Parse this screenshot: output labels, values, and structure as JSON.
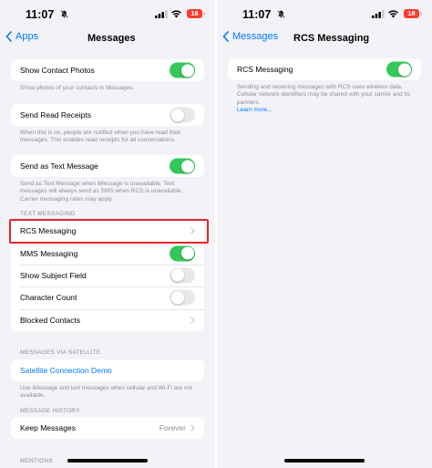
{
  "status": {
    "time": "11:07",
    "battery": "18"
  },
  "left": {
    "nav": {
      "back_label": "Apps",
      "title": "Messages"
    },
    "show_contact_photos": {
      "label": "Show Contact Photos",
      "on": true,
      "footnote": "Show photos of your contacts in Messages."
    },
    "send_read_receipts": {
      "label": "Send Read Receipts",
      "on": false,
      "footnote": "When this is on, people are notified when you have read their messages. This enables read receipts for all conversations."
    },
    "send_as_text": {
      "label": "Send as Text Message",
      "on": true,
      "footnote": "Send as Text Message when iMessage is unavailable. Text messages will always send as SMS when RCS is unavailable. Carrier messaging rates may apply."
    },
    "text_messaging": {
      "header": "TEXT MESSAGING",
      "rcs": "RCS Messaging",
      "mms": {
        "label": "MMS Messaging",
        "on": true
      },
      "subject": {
        "label": "Show Subject Field",
        "on": false
      },
      "char_count": {
        "label": "Character Count",
        "on": false
      },
      "blocked": "Blocked Contacts"
    },
    "satellite": {
      "header": "MESSAGES VIA SATELLITE",
      "demo": "Satellite Connection Demo",
      "footnote": "Use iMessage and text messages when cellular and Wi-Fi are not available."
    },
    "history": {
      "header": "MESSAGE HISTORY",
      "keep_label": "Keep Messages",
      "keep_value": "Forever"
    },
    "mentions_header": "MENTIONS"
  },
  "right": {
    "nav": {
      "back_label": "Messages",
      "title": "RCS Messaging"
    },
    "rcs": {
      "label": "RCS Messaging",
      "on": true
    },
    "footnote": "Sending and receiving messages with RCS uses wireless data. Cellular network identifiers may be shared with your carrier and its partners.",
    "learn_more": "Learn more..."
  },
  "colors": {
    "accent": "#007aff",
    "toggle_on": "#34c759",
    "highlight": "#e0262d",
    "battery": "#ff3b30"
  }
}
